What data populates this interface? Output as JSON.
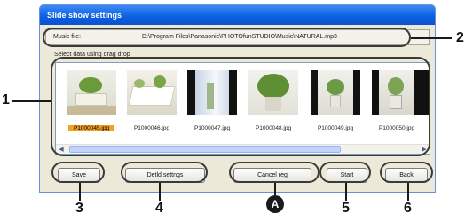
{
  "window": {
    "title": "Slide show settings"
  },
  "music": {
    "label": "Music file:",
    "path": "D:\\Program Files\\Panasonic\\PHOTOfunSTUDIO\\Music\\NATURAL.mp3"
  },
  "select_label": "Select data using drag  drop",
  "thumbnails": [
    {
      "file": "P1000045.jpg",
      "selected": true
    },
    {
      "file": "P1000046.jpg",
      "selected": false
    },
    {
      "file": "P1000047.jpg",
      "selected": false
    },
    {
      "file": "P1000048.jpg",
      "selected": false
    },
    {
      "file": "P1000049.jpg",
      "selected": false
    },
    {
      "file": "P1000050.jpg",
      "selected": false
    }
  ],
  "buttons": {
    "save": "Save",
    "detail": "Detld settngs",
    "cancel": "Cancel reg",
    "start": "Start",
    "back": "Back"
  },
  "callouts": {
    "n1": "1",
    "n2": "2",
    "n3": "3",
    "n4": "4",
    "nA": "A",
    "n5": "5",
    "n6": "6"
  },
  "colors": {
    "selection": "#f5a020",
    "titlebar": "#0a5fe0",
    "window_bg": "#ece9d8"
  }
}
